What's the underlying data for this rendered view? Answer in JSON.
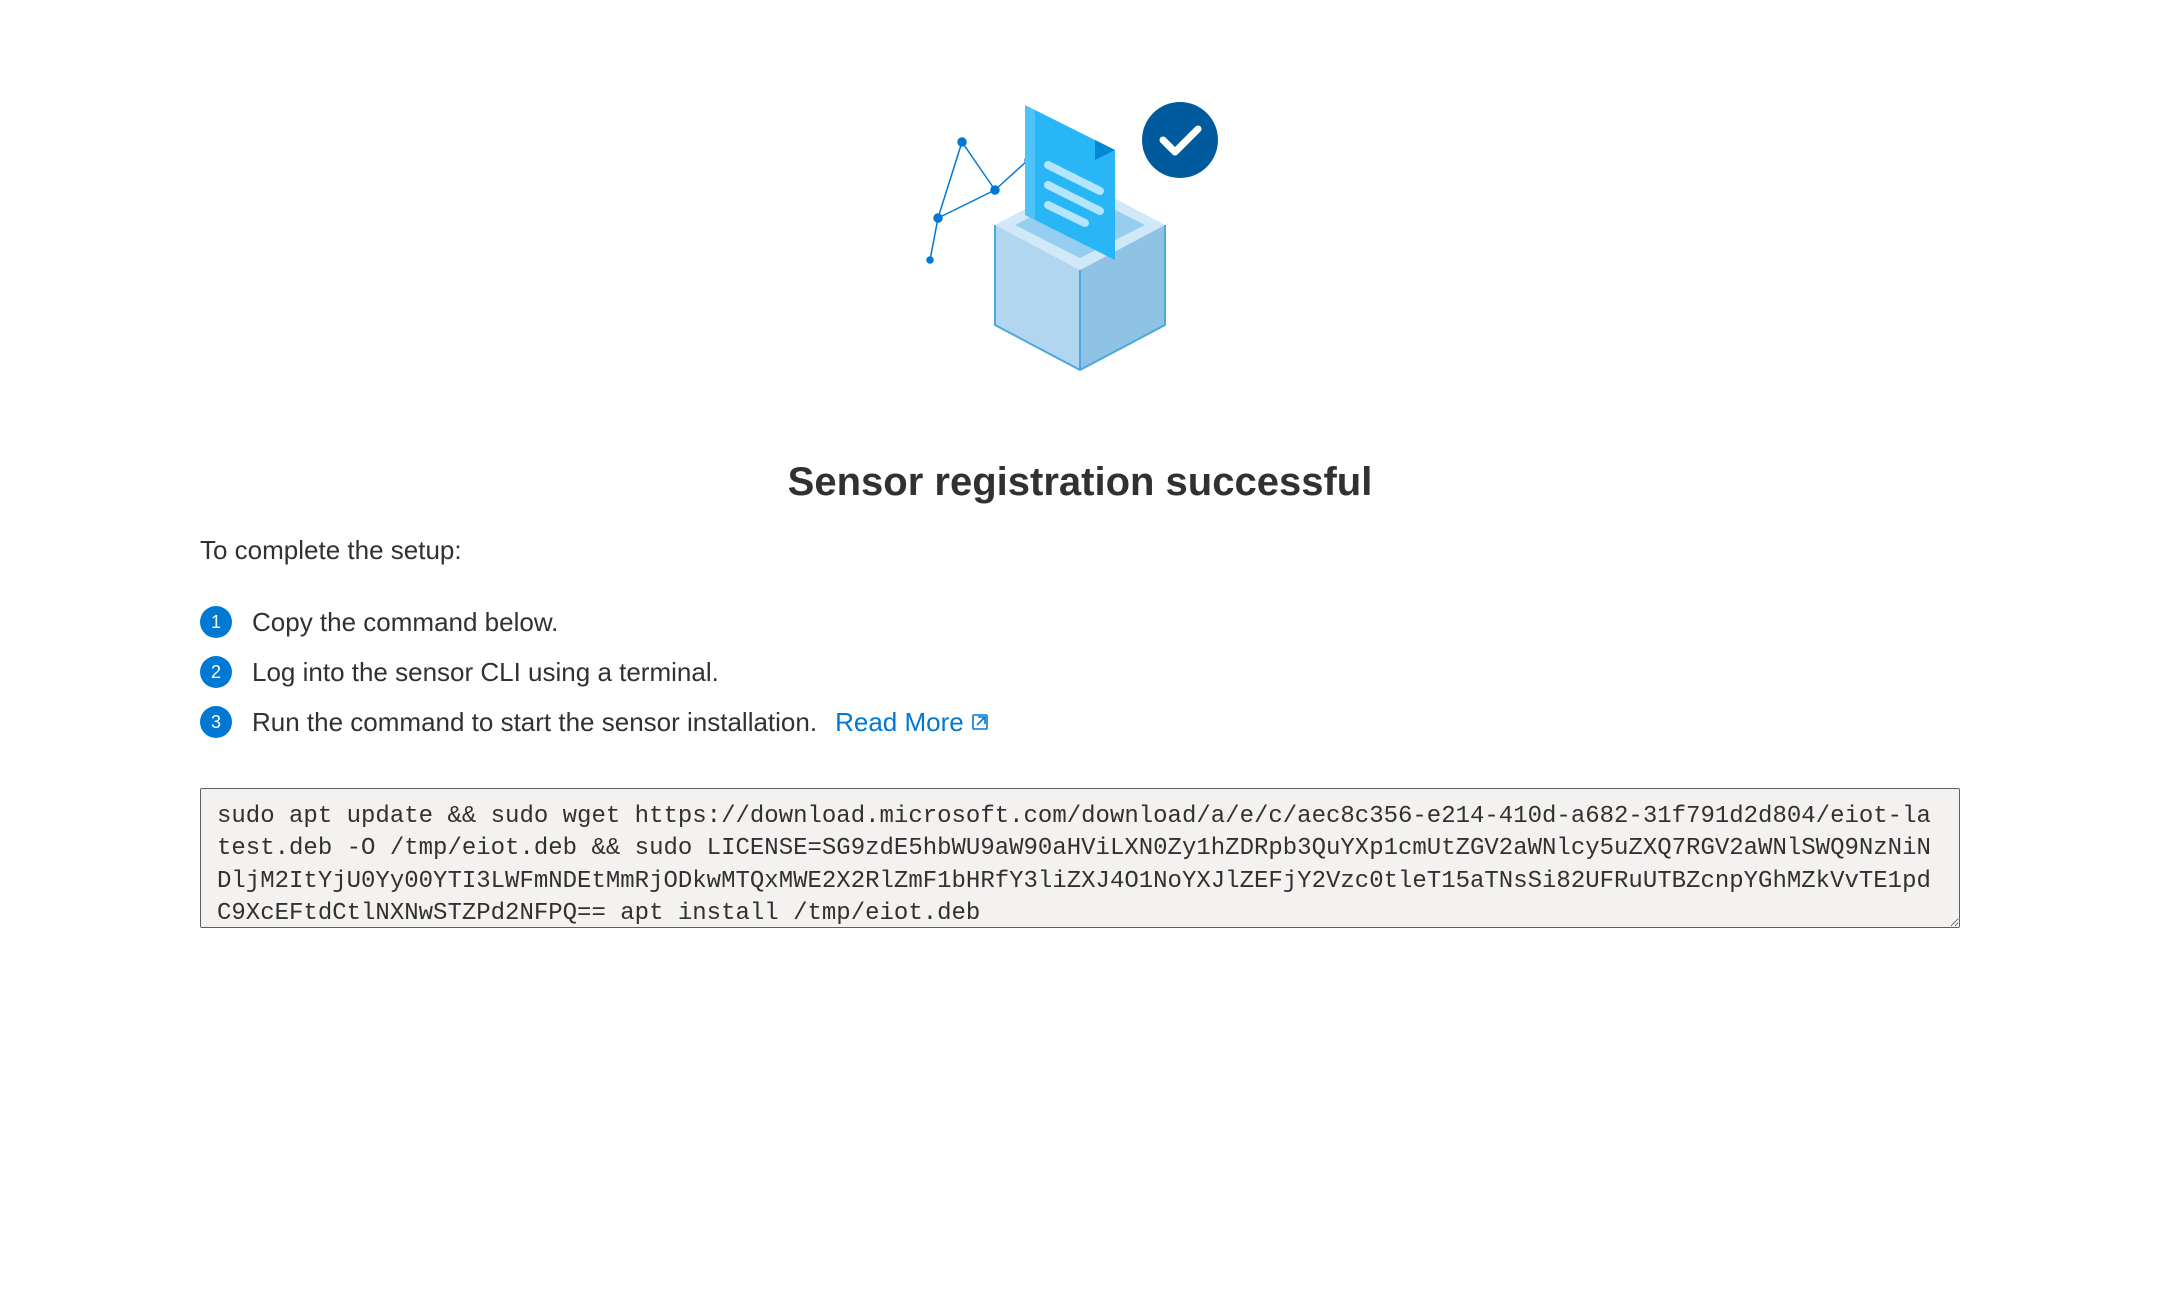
{
  "title": "Sensor registration successful",
  "subtitle": "To complete the setup:",
  "steps": [
    {
      "num": "1",
      "text": "Copy the command below."
    },
    {
      "num": "2",
      "text": "Log into the sensor CLI using a terminal."
    },
    {
      "num": "3",
      "text": "Run the command to start the sensor installation."
    }
  ],
  "readMore": "Read More",
  "command": "sudo apt update && sudo wget https://download.microsoft.com/download/a/e/c/aec8c356-e214-410d-a682-31f791d2d804/eiot-latest.deb -O /tmp/eiot.deb && sudo LICENSE=SG9zdE5hbWU9aW90aHViLXN0Zy1hZDRpb3QuYXp1cmUtZGV2aWNlcy5uZXQ7RGV2aWNlSWQ9NzNiNDljM2ItYjU0Yy00YTI3LWFmNDEtMmRjODkwMTQxMWE2X2RlZmF1bHRfY3liZXJ4O1NoYXJlZEFjY2Vzc0tleT15aTNsSi82UFRuUTBZcnpYGhMZkVvTE1pdC9XcEFtdCtlNXNwSTZPd2NFPQ== apt install /tmp/eiot.deb"
}
